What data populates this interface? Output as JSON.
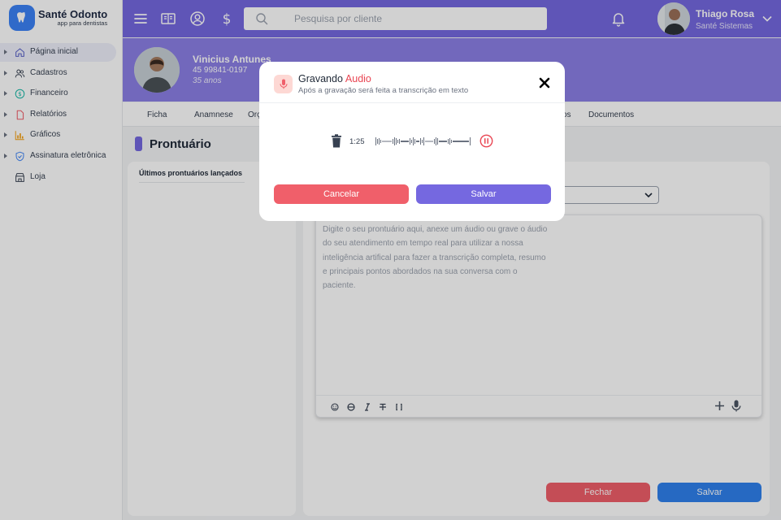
{
  "brand": {
    "name": "Santé Odonto",
    "tagline": "app para dentistas"
  },
  "sidebar": {
    "items": [
      {
        "label": "Página inicial",
        "icon": "home-icon",
        "active": true
      },
      {
        "label": "Cadastros",
        "icon": "users-icon"
      },
      {
        "label": "Financeiro",
        "icon": "dollar-icon"
      },
      {
        "label": "Relatórios",
        "icon": "file-icon"
      },
      {
        "label": "Gráficos",
        "icon": "chart-icon"
      },
      {
        "label": "Assinatura eletrônica",
        "icon": "shield-icon"
      },
      {
        "label": "Loja",
        "icon": "store-icon"
      }
    ]
  },
  "topbar": {
    "search_placeholder": "Pesquisa por cliente",
    "user": {
      "name": "Thiago Rosa",
      "org": "Santé Sistemas"
    }
  },
  "patient": {
    "name": "Vinicius Antunes",
    "phone": "45 99841-0197",
    "age": "35 anos"
  },
  "tabs": [
    "Ficha",
    "Anamnese",
    "Orç",
    "os",
    "Documentos"
  ],
  "page": {
    "title": "Prontuário",
    "left_card_title": "Últimos prontuários lançados",
    "editor_placeholder": "Digite o seu prontuário aqui, anexe um áudio ou grave o áudio do seu atendimento em tempo real para utilizar a nossa inteligência artifical para fazer a transcrição completa, resumo e principais pontos abordados na sua conversa com o paciente.",
    "close_label": "Fechar",
    "save_label": "Salvar"
  },
  "modal": {
    "title": "Gravando",
    "title_accent": "Audio",
    "subtitle": "Após a gravação será feita a transcrição em texto",
    "timer": "1:25",
    "cancel_label": "Cancelar",
    "save_label": "Salvar"
  },
  "colors": {
    "primary": "#7568e0",
    "danger": "#f05f6a",
    "blue": "#2f80ed",
    "accent_red": "#e94552"
  }
}
